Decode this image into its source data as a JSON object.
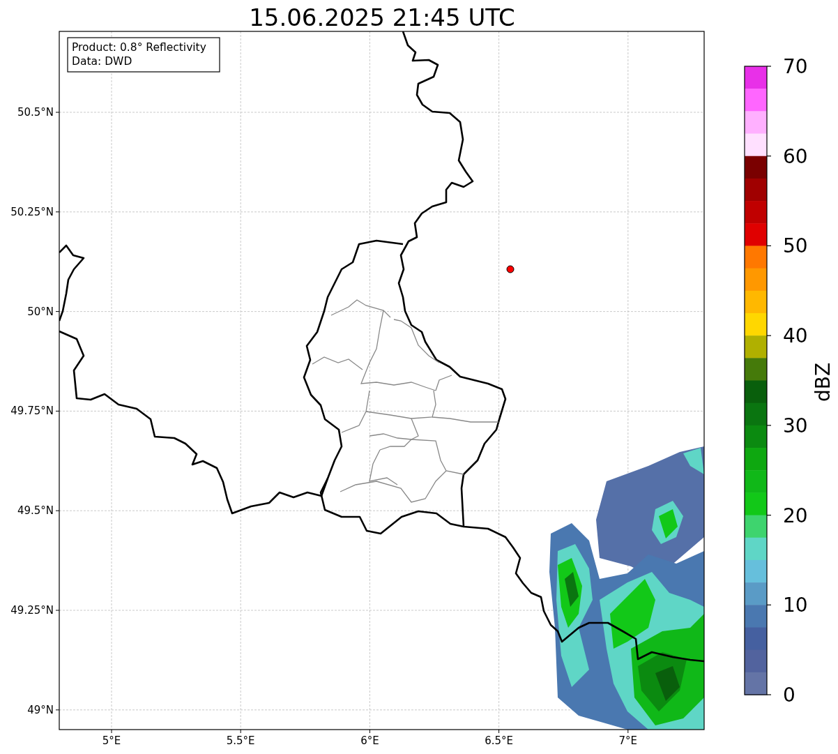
{
  "title": "15.06.2025 21:45 UTC",
  "info_box": {
    "lines": [
      "Product: 0.8° Reflectivity",
      "Data: DWD"
    ]
  },
  "map": {
    "x_ticks": [
      "5°E",
      "5.5°E",
      "6°E",
      "6.5°E",
      "7°E"
    ],
    "y_ticks": [
      "50.5°N",
      "50.25°N",
      "50°N",
      "49.75°N",
      "49.5°N",
      "49.25°N",
      "49°N"
    ]
  },
  "colorbar": {
    "label": "dBZ",
    "ticks": [
      "70",
      "60",
      "50",
      "40",
      "30",
      "20",
      "10",
      "0"
    ],
    "bands": [
      {
        "color": "#e830e8"
      },
      {
        "color": "#ff66ff"
      },
      {
        "color": "#ffb0ff"
      },
      {
        "color": "#ffe0ff"
      },
      {
        "color": "#7a0000"
      },
      {
        "color": "#a00000"
      },
      {
        "color": "#c00000"
      },
      {
        "color": "#e00000"
      },
      {
        "color": "#ff7800"
      },
      {
        "color": "#ff9800"
      },
      {
        "color": "#ffb800"
      },
      {
        "color": "#ffd700"
      },
      {
        "color": "#b0b000"
      },
      {
        "color": "#457a0a"
      },
      {
        "color": "#095f0c"
      },
      {
        "color": "#0a7510"
      },
      {
        "color": "#0b8a10"
      },
      {
        "color": "#0ea810"
      },
      {
        "color": "#10b818"
      },
      {
        "color": "#12c818"
      },
      {
        "color": "#3ed46e"
      },
      {
        "color": "#5fd6c6"
      },
      {
        "color": "#66bfdc"
      },
      {
        "color": "#5a9bc6"
      },
      {
        "color": "#4a78b0"
      },
      {
        "color": "#4560a0"
      },
      {
        "color": "#52639e"
      },
      {
        "color": "#6474a6"
      }
    ]
  }
}
